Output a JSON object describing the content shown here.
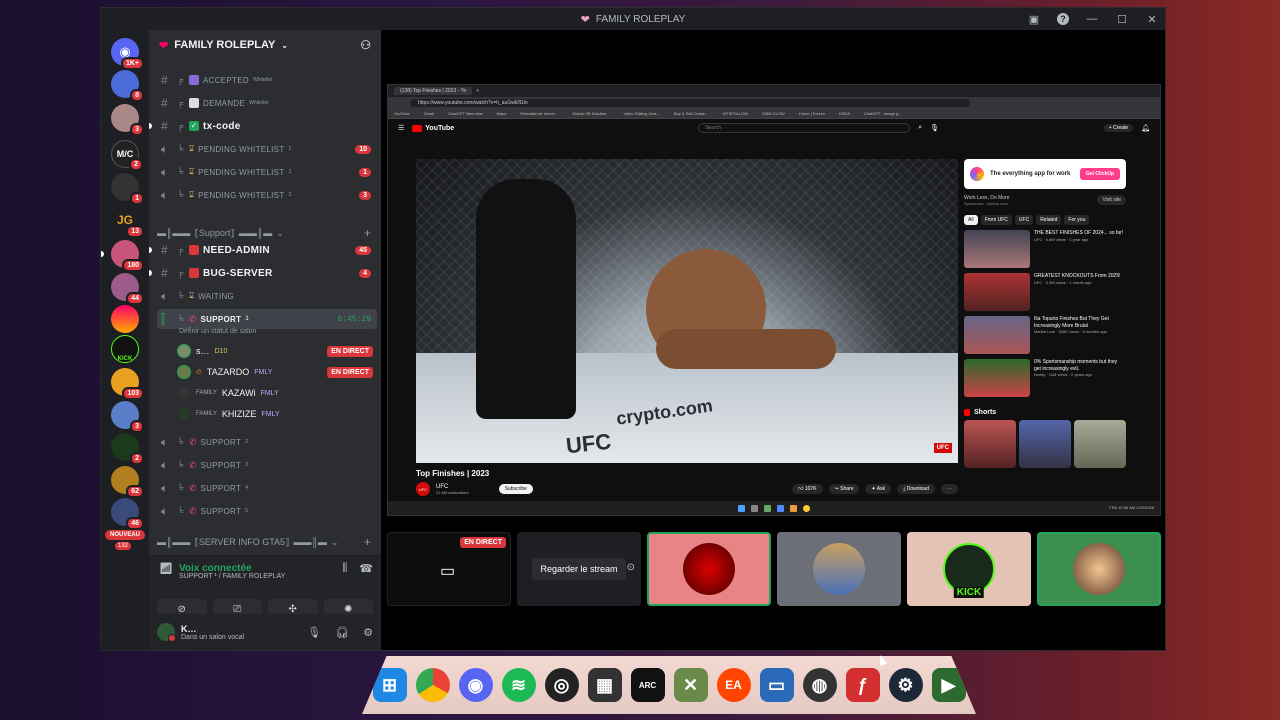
{
  "window": {
    "title": "FAMILY ROLEPLAY"
  },
  "rail": {
    "badges": [
      "1K+",
      "8",
      "3",
      "2",
      "1",
      "13",
      "180",
      "44",
      "",
      "103",
      "3",
      "2",
      "62",
      "46",
      "132"
    ],
    "nouveau": "NOUVEAU",
    "kick": "KICK"
  },
  "server": {
    "name": "FAMILY ROLEPLAY"
  },
  "channels": [
    {
      "name": "ACCEPTED",
      "sup": "Whitelist"
    },
    {
      "name": "DEMANDE",
      "sup": "Whitelist"
    },
    {
      "name": "tx-code"
    },
    {
      "name": "PENDING WHITELIST",
      "sup": "1",
      "count": "10"
    },
    {
      "name": "PENDING WHITELIST",
      "sup": "2",
      "count": "1"
    },
    {
      "name": "PENDING WHITELIST",
      "sup": "3",
      "count": "3"
    }
  ],
  "category_support": "⟦Support⟧",
  "support_channels": [
    {
      "name": "NEED-ADMIN",
      "count": "45"
    },
    {
      "name": "BUG-SERVER",
      "count": "4"
    },
    {
      "name": "WAITING"
    }
  ],
  "voice": {
    "channel": "SUPPORT",
    "sup": "1",
    "timer": "6:45:29",
    "status": "Définir un statut de salon",
    "users": [
      {
        "name": "s…",
        "tag": "D10",
        "live": "EN DIRECT"
      },
      {
        "name": "TAZARDO",
        "tag": "FMLY",
        "live": "EN DIRECT"
      },
      {
        "name": "KAZAWi",
        "prefix": "FAMILY",
        "tag": "FMLY"
      },
      {
        "name": "KHIZIZE",
        "prefix": "FAMILY",
        "tag": "FMLY"
      }
    ],
    "other": [
      {
        "name": "SUPPORT",
        "sup": "2"
      },
      {
        "name": "SUPPORT",
        "sup": "3"
      },
      {
        "name": "SUPPORT",
        "sup": "4"
      },
      {
        "name": "SUPPORT",
        "sup": "5"
      }
    ]
  },
  "category_info": "⟦SERVER INFO GTA5⟧",
  "voice_panel": {
    "title": "Voix connectée",
    "sub": "SUPPORT ¹ / FAMILY ROLEPLAY"
  },
  "user_panel": {
    "name": "K…",
    "status": "Dans un salon vocal"
  },
  "stream": {
    "tab_title": "(138) Top Finishes | 2023 - Yo",
    "url": "https://www.youtube.com/watch?v=h_auGwEfGIo",
    "bookmarks": [
      "YouTube",
      "Gmail",
      "ChatGPT New chat",
      "Maps",
      "Résultats de recher...",
      "Global HR Solution...",
      "Video Editing Jobs...",
      "Buy & Sell Online...",
      "VITSFOLLOW",
      "SMM GLOW",
      "Home | Forkex",
      "KREA",
      "ChatGPT - image g..."
    ],
    "yt_logo": "YouTube",
    "search": "Search",
    "create": "+ Create",
    "video_title": "Top Finishes | 2023",
    "channel": "UFC",
    "subs": "21.6M subscribers",
    "subscribe": "Subscribe",
    "likes": "107K",
    "share": "Share",
    "ask": "Ask",
    "download": "Download",
    "floor_text": "crypto.com",
    "floor_ufc": "UFC",
    "ad_title": "The everything app for work",
    "ad_cta": "Get ClickUp",
    "ad_line": "Work Less, Do More",
    "ad_sponsored": "Sponsored · clickup.com",
    "ad_visit": "Visit site",
    "chips": [
      "All",
      "From UFC",
      "UFC",
      "Related",
      "For you"
    ],
    "recs": [
      {
        "title": "THE BEST FINISHES OF 2024... so far!",
        "meta": "UFC · 6.8M views · 1 year ago"
      },
      {
        "title": "GREATEST KNOCKOUTS From 2025!",
        "meta": "UFC · 3.3M views · 1 month ago"
      },
      {
        "title": "Ilia Topuria Finishes But They Get Increasingly More Brutal",
        "meta": "Martial Lore · 545K views · 6 months ago"
      },
      {
        "title": "0% Sportsmanship moments but they get increasingly eviL",
        "meta": "Ninety · 11M views · 2 years ago"
      }
    ],
    "shorts": "Shorts",
    "clock": "10:56 AM\n1/20/2026",
    "lang": "FRA"
  },
  "tiles": {
    "live": "EN DIRECT",
    "watch": "Regarder le stream",
    "kick": "KICK"
  },
  "colors": {
    "discord_green": "#23a559",
    "discord_red": "#da373c",
    "accent_pink": "#ff3d8b"
  }
}
